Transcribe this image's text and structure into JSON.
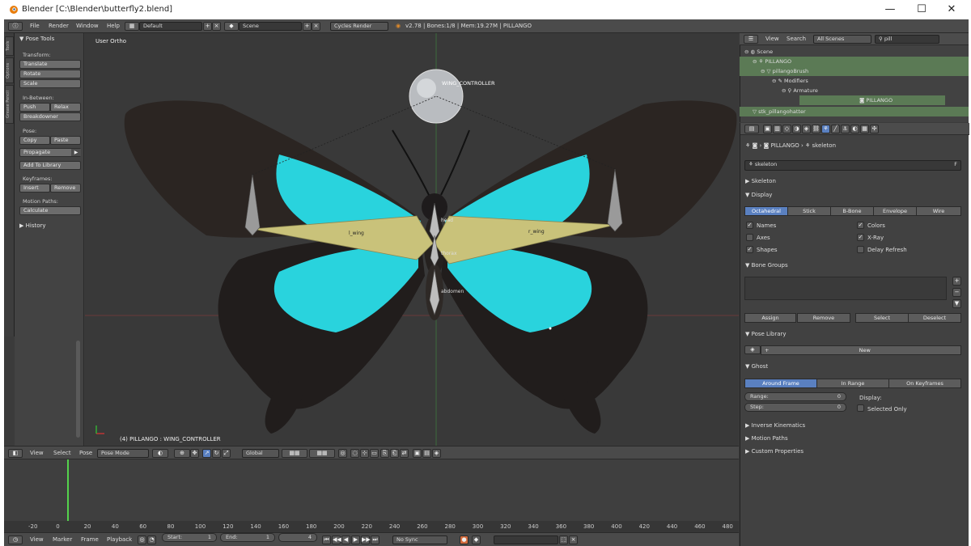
{
  "window": {
    "title": "Blender [C:\\Blender\\butterfly2.blend]",
    "min": "—",
    "max": "☐",
    "close": "✕"
  },
  "topbar": {
    "menus": [
      "File",
      "Render",
      "Window",
      "Help"
    ],
    "layout": "Default",
    "scene": "Scene",
    "engine": "Cycles Render",
    "stats": "v2.78 | Bones:1/8 | Mem:19.27M | PILLANGO"
  },
  "shelf": {
    "tabs": [
      "Tools",
      "Options",
      "Grease Pencil"
    ],
    "title": "Pose Tools",
    "transform_label": "Transform:",
    "translate": "Translate",
    "rotate": "Rotate",
    "scale": "Scale",
    "inbetween_label": "In-Between:",
    "push": "Push",
    "relax": "Relax",
    "breakdowner": "Breakdowner",
    "pose_label": "Pose:",
    "copy": "Copy",
    "paste": "Paste",
    "propagate": "Propagate",
    "add_to_library": "Add To Library",
    "keyframes_label": "Keyframes:",
    "insert": "Insert",
    "remove": "Remove",
    "motion_paths_label": "Motion Paths:",
    "calculate": "Calculate",
    "history": "History"
  },
  "viewport": {
    "view_label": "User Ortho",
    "bone_labels": {
      "controller": "WING_CONTROLLER",
      "l_wing": "l_wing",
      "r_wing": "r_wing",
      "head": "head",
      "thorax": "thorax",
      "abdomen": "abdomen"
    },
    "status": "(4) PILLANGO : WING_CONTROLLER",
    "colors": {
      "wing_dark": "#2b2522",
      "wing_cyan": "#29d3dd",
      "bone": "#c9c27a"
    }
  },
  "vphead": {
    "menus": [
      "View",
      "Select",
      "Pose"
    ],
    "mode": "Pose Mode",
    "orientation": "Global"
  },
  "timeline": {
    "ticks": [
      "-20",
      "0",
      "20",
      "40",
      "60",
      "80",
      "100",
      "120",
      "140",
      "160",
      "180",
      "200",
      "220",
      "240",
      "260",
      "280",
      "300",
      "320",
      "340",
      "360",
      "380",
      "400",
      "420",
      "440",
      "460",
      "480"
    ],
    "menus": [
      "View",
      "Marker",
      "Frame",
      "Playback"
    ],
    "start": "Start:",
    "start_val": "1",
    "end": "End:",
    "end_val": "1",
    "current": "4",
    "sync": "No Sync"
  },
  "outliner": {
    "menus": [
      "View",
      "Search"
    ],
    "filter": "All Scenes",
    "search": "pill",
    "rows": [
      "Scene",
      "PILLANGO",
      "pillangoBrush",
      "Modifiers",
      "Armature",
      "PILLANGO",
      "stk_pillangohatter"
    ]
  },
  "props": {
    "breadcrumb": [
      "PILLANGO",
      "skeleton"
    ],
    "datablock": "skeleton",
    "datablock_f": "F",
    "skeleton": "Skeleton",
    "display": "Display",
    "display_modes": [
      "Octahedral",
      "Stick",
      "B-Bone",
      "Envelope",
      "Wire"
    ],
    "names": "Names",
    "colors": "Colors",
    "axes": "Axes",
    "xray": "X-Ray",
    "shapes": "Shapes",
    "delay_refresh": "Delay Refresh",
    "bone_groups": "Bone Groups",
    "assign": "Assign",
    "remove": "Remove",
    "select": "Select",
    "deselect": "Deselect",
    "pose_library": "Pose Library",
    "new": "New",
    "ghost": "Ghost",
    "ghost_modes": [
      "Around Frame",
      "In Range",
      "On Keyframes"
    ],
    "range": "Range:",
    "range_val": "0",
    "step": "Step:",
    "step_val": "0",
    "display_label": "Display:",
    "selected_only": "Selected Only",
    "ik": "Inverse Kinematics",
    "motion_paths": "Motion Paths",
    "custom_props": "Custom Properties"
  }
}
